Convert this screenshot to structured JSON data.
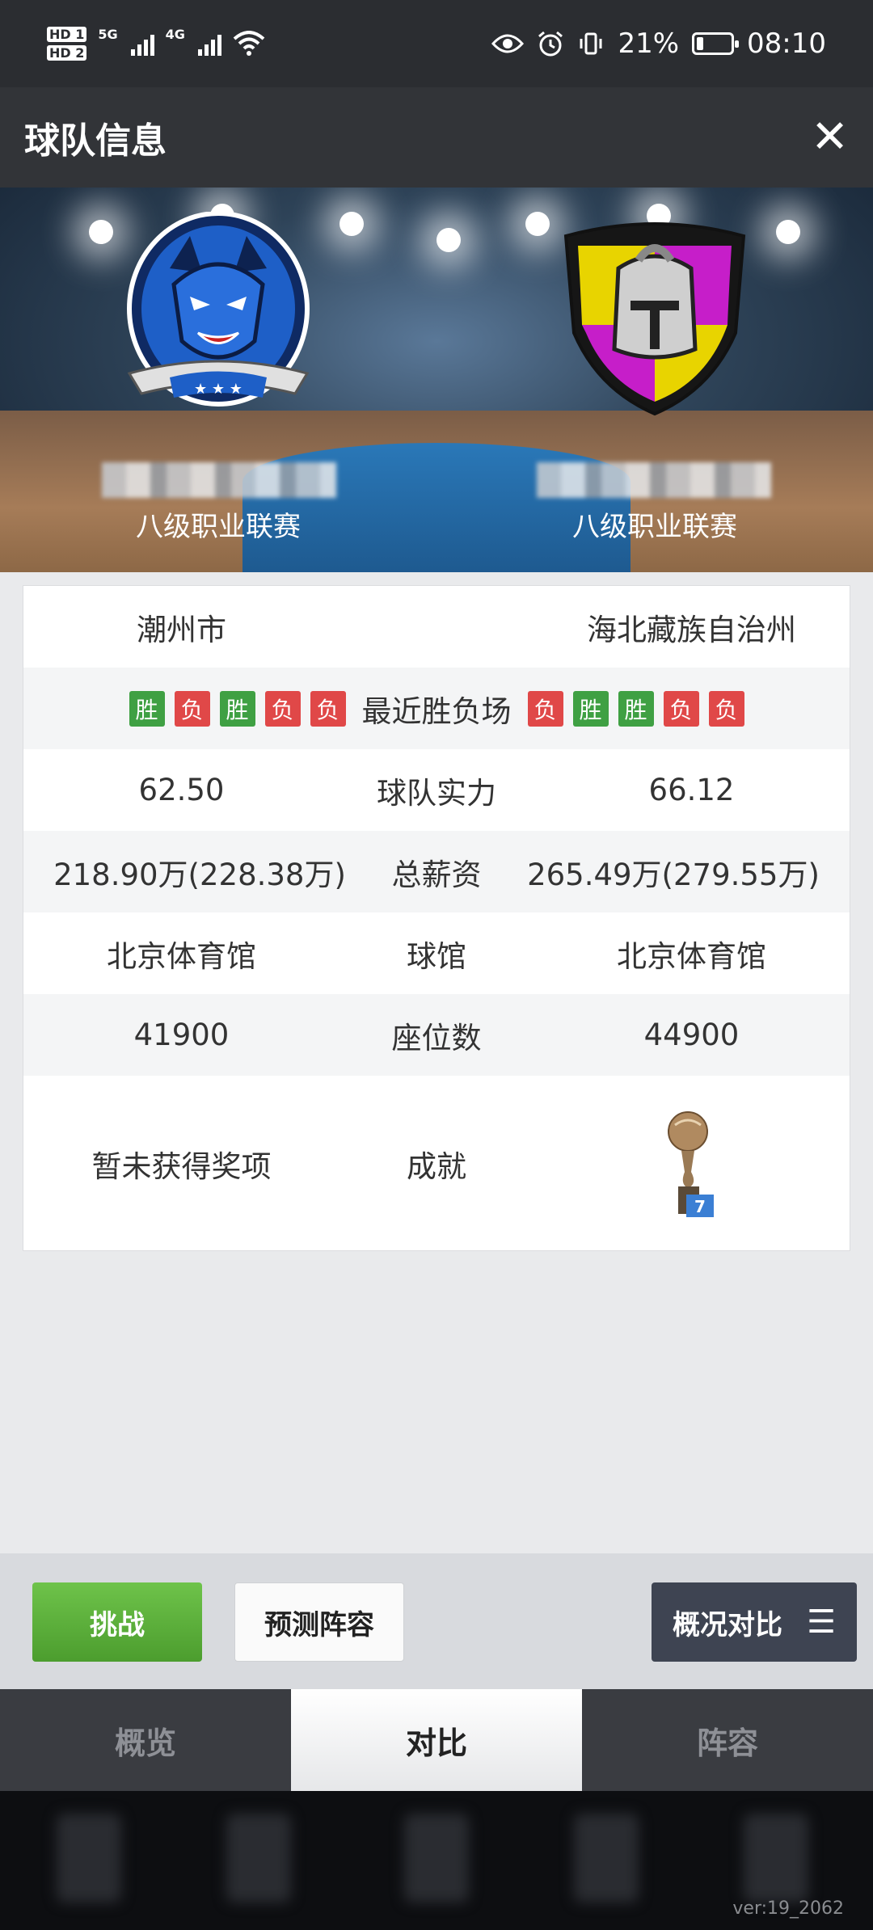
{
  "status": {
    "time": "08:10",
    "battery": "21%",
    "battery_level": 0.21,
    "network_1": "5G",
    "network_2": "4G",
    "sim_1": "HD 1",
    "sim_2": "HD 2"
  },
  "header": {
    "title": "球队信息"
  },
  "teams": {
    "left": {
      "league": "八级职业联赛",
      "logo": "wolf-logo"
    },
    "right": {
      "league": "八级职业联赛",
      "logo": "spartan-helmet-logo"
    }
  },
  "info": {
    "city_left": "潮州市",
    "city_right": "海北藏族自治州",
    "recent_label": "最近胜负场",
    "recent_left": [
      "胜",
      "负",
      "胜",
      "负",
      "负"
    ],
    "recent_right": [
      "负",
      "胜",
      "胜",
      "负",
      "负"
    ],
    "strength_left": "62.50",
    "strength_label": "球队实力",
    "strength_right": "66.12",
    "salary_left": "218.90万(228.38万)",
    "salary_label": "总薪资",
    "salary_right": "265.49万(279.55万)",
    "arena_left": "北京体育馆",
    "arena_label": "球馆",
    "arena_right": "北京体育馆",
    "seats_left": "41900",
    "seats_label": "座位数",
    "seats_right": "44900",
    "achievement_left": "暂未获得奖项",
    "achievement_label": "成就",
    "trophy_count": "7"
  },
  "actions": {
    "challenge": "挑战",
    "predict": "预测阵容",
    "compare": "概况对比"
  },
  "tabs": [
    "概览",
    "对比",
    "阵容"
  ],
  "version": "ver:19_2062",
  "colors": {
    "win": "#3fa043",
    "loss": "#e04848"
  }
}
